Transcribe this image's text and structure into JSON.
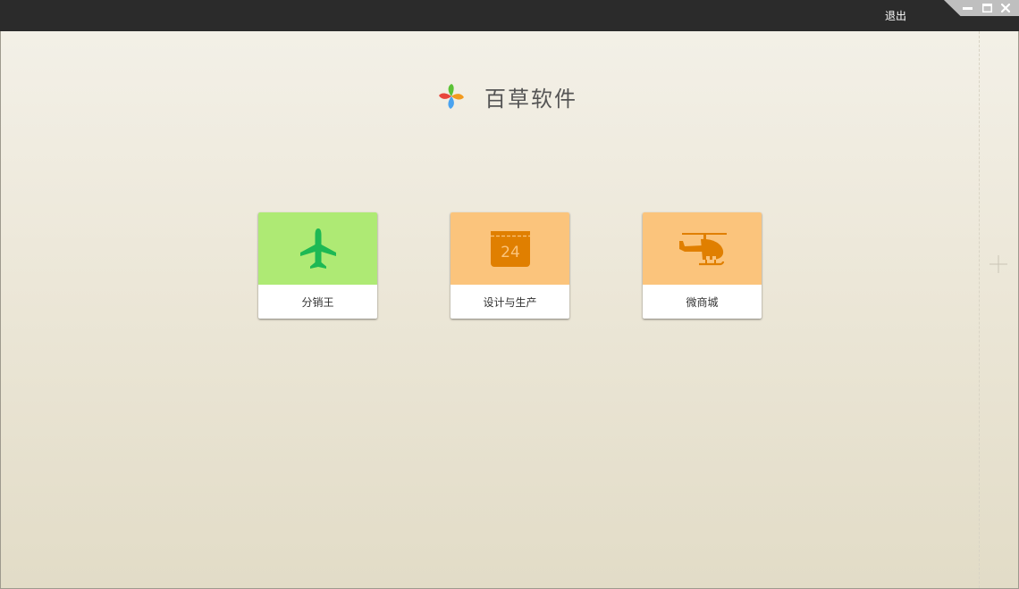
{
  "titlebar": {
    "exit_label": "退出",
    "controls": [
      "minimize-icon",
      "maximize-icon",
      "close-icon"
    ]
  },
  "logo": {
    "text": "百草软件"
  },
  "tiles": [
    {
      "label": "分销王",
      "icon": "airplane-icon",
      "color": "#aeea74",
      "icon_color": "#1db954"
    },
    {
      "label": "设计与生产",
      "icon": "calendar-icon",
      "color": "#fbc47c",
      "icon_color": "#e07f00",
      "icon_text": "24"
    },
    {
      "label": "微商城",
      "icon": "helicopter-icon",
      "color": "#fbc47c",
      "icon_color": "#e07f00"
    }
  ],
  "side": {
    "icon": "plus-icon"
  }
}
